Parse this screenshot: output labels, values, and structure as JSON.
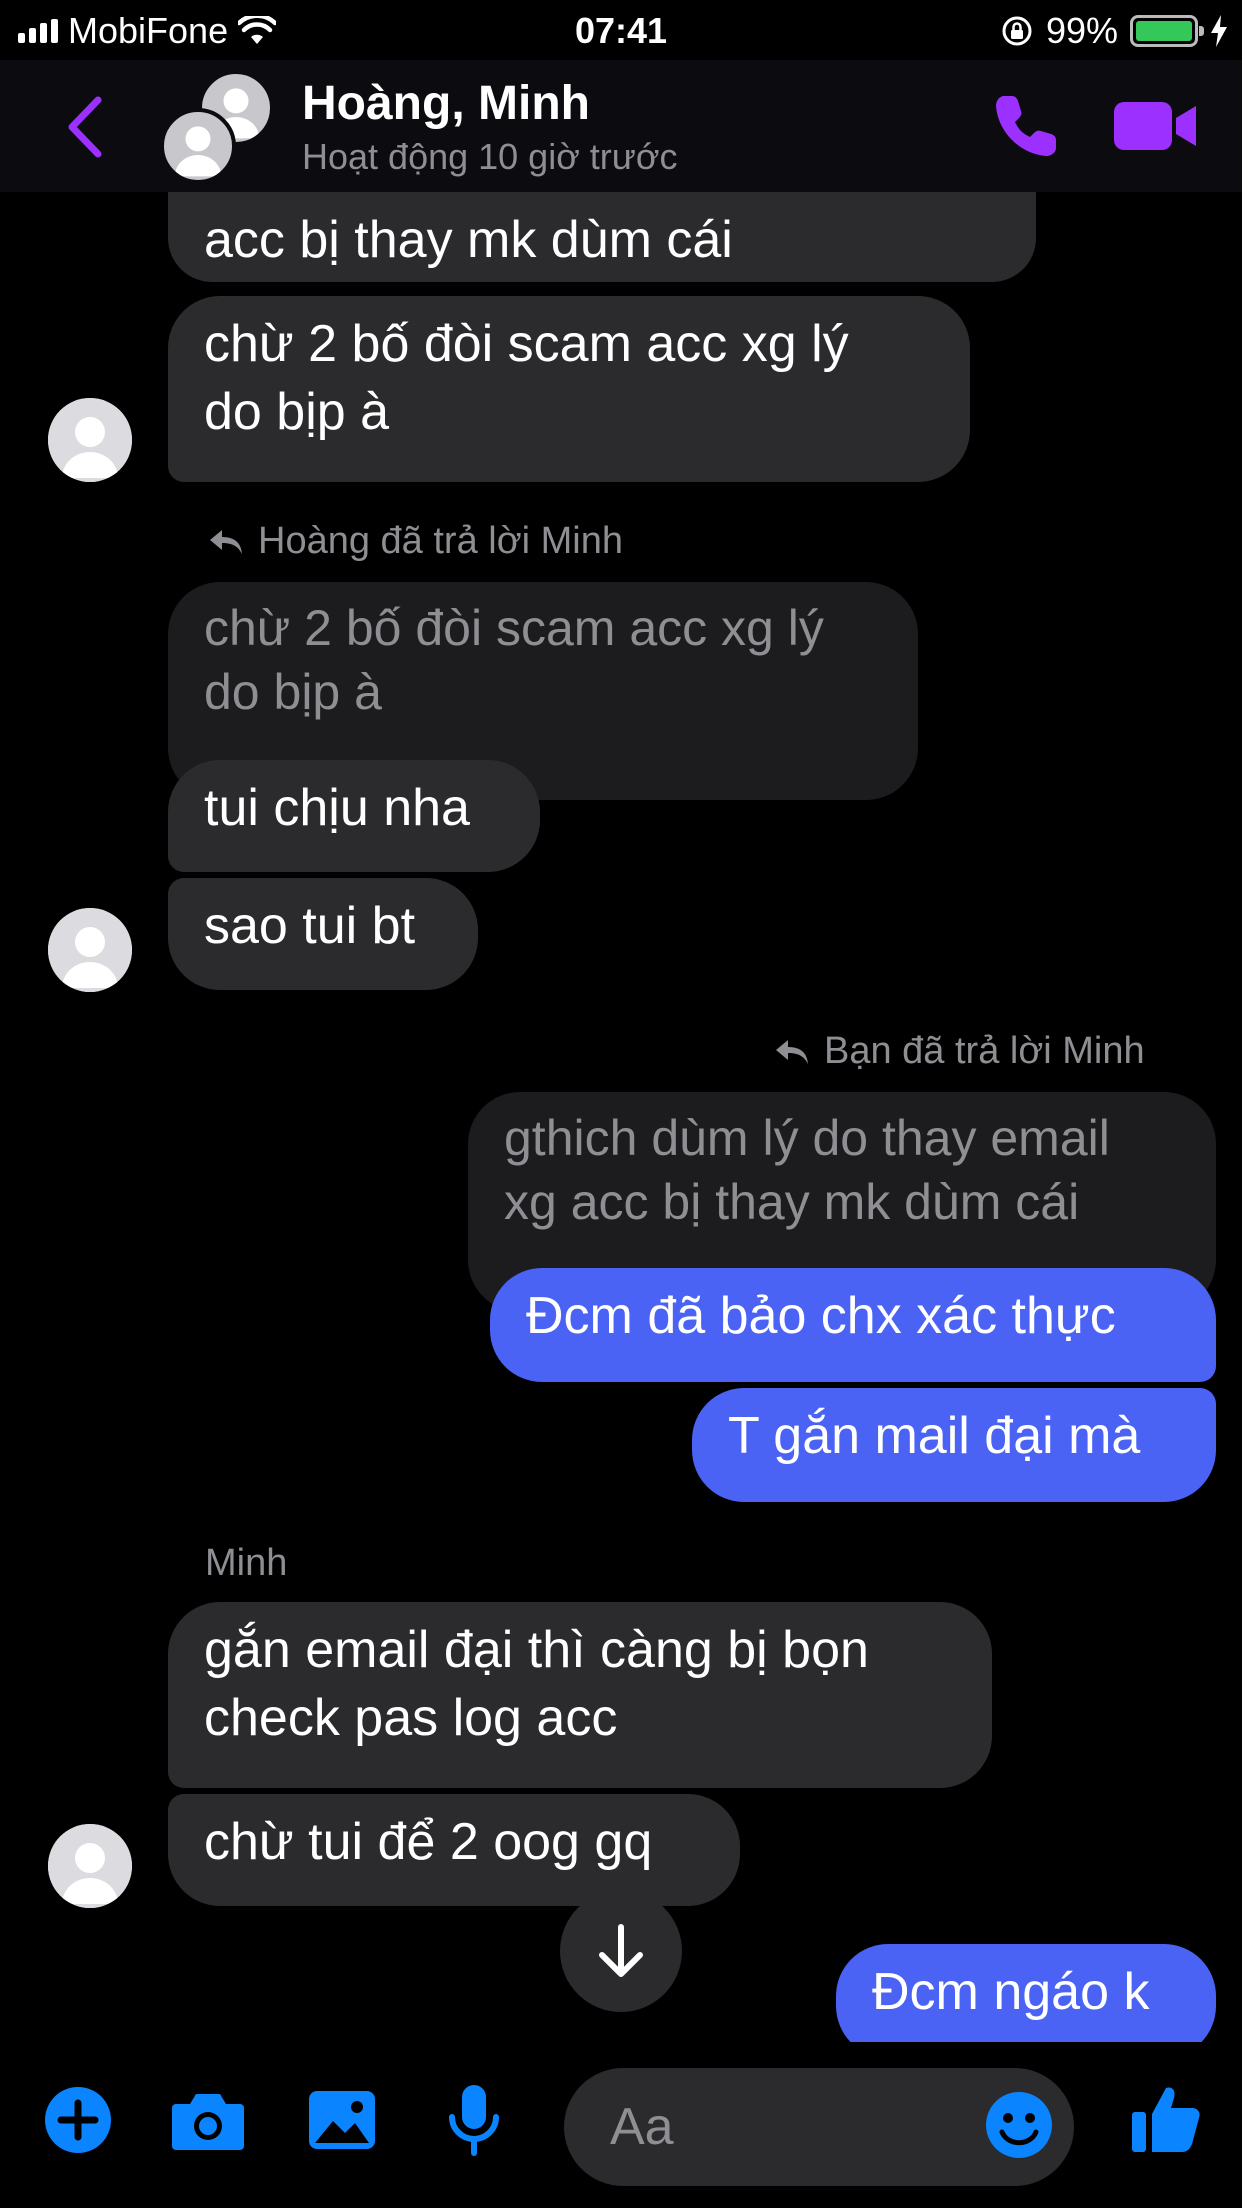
{
  "status_bar": {
    "carrier": "MobiFone",
    "time": "07:41",
    "battery": "99%"
  },
  "header": {
    "title": "Hoàng, Minh",
    "subtitle": "Hoạt động 10 giờ trước"
  },
  "colors": {
    "accent": "#9b30ff",
    "outgoing_bubble": "#4a63f4",
    "incoming_bubble": "#2b2b2e",
    "blue_icons": "#0a84ff"
  },
  "messages": {
    "m1": "acc bị thay mk dùm cái",
    "m2_line1": "chừ 2 bố đòi scam acc xg lý",
    "m2_line2": "do bịp à",
    "reply1_label": "Hoàng đã trả lời Minh",
    "quote1_line1": "chừ 2 bố đòi scam acc xg lý",
    "quote1_line2": "do bịp à",
    "m3": "tui chịu nha",
    "m4": "sao tui bt",
    "reply2_label": "Bạn đã trả lời Minh",
    "quote2_line1": "gthich dùm lý do thay email",
    "quote2_line2": "xg acc bị thay mk dùm cái",
    "m5": "Đcm đã bảo chx xác thực",
    "m6": "T gắn mail đại mà",
    "sender": "Minh",
    "m7_line1": "gắn email đại thì càng bị bọn",
    "m7_line2": "check pas log acc",
    "m8": "chừ tui để 2 oog gq",
    "m9": "Đcm ngáo k"
  },
  "composer": {
    "placeholder": "Aa"
  },
  "icons": [
    "back-icon",
    "phone-icon",
    "video-icon",
    "plus-icon",
    "camera-icon",
    "image-icon",
    "mic-icon",
    "emoji-icon",
    "thumbs-up-icon",
    "arrow-down-icon"
  ]
}
